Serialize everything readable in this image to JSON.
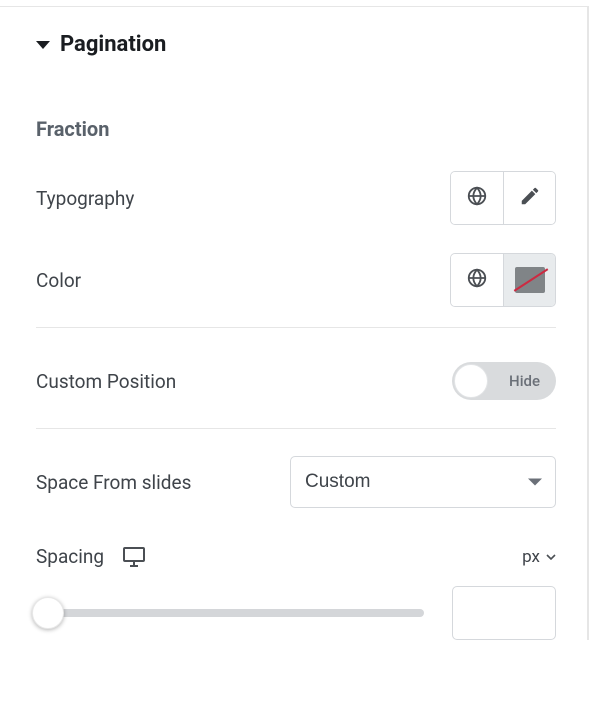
{
  "section": {
    "title": "Pagination"
  },
  "fraction": {
    "heading": "Fraction",
    "typography": {
      "label": "Typography"
    },
    "color": {
      "label": "Color"
    }
  },
  "customPosition": {
    "label": "Custom Position",
    "toggle_label": "Hide"
  },
  "spaceFromSlides": {
    "label": "Space From slides",
    "value": "Custom"
  },
  "spacing": {
    "label": "Spacing",
    "unit": "px",
    "value": ""
  }
}
